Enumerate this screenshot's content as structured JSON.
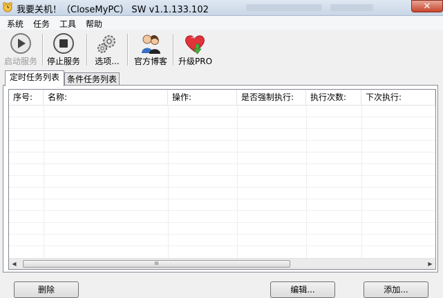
{
  "window": {
    "title": "我要关机！（CloseMyPC） SW v1.1.133.102",
    "close_glyph": "✕"
  },
  "menu": [
    "系统",
    "任务",
    "工具",
    "帮助"
  ],
  "toolbar": {
    "start_label": "启动服务",
    "stop_label": "停止服务",
    "options_label": "选项...",
    "blog_label": "官方博客",
    "upgrade_label": "升级PRO"
  },
  "tabs": [
    "定时任务列表",
    "条件任务列表"
  ],
  "table": {
    "columns": [
      "序号:",
      "名称:",
      "操作:",
      "是否强制执行:",
      "执行次数:",
      "下次执行:"
    ]
  },
  "scrollbar": {
    "left": "◀",
    "right": "▶",
    "grip": "III"
  },
  "buttons": {
    "delete": "删除",
    "edit": "编辑...",
    "add": "添加..."
  },
  "colors": {
    "title_bg": "#c9d6e6",
    "close_red": "#c7462c",
    "upgrade_heart": "#e2323a",
    "arrow_green": "#4caf3e"
  }
}
